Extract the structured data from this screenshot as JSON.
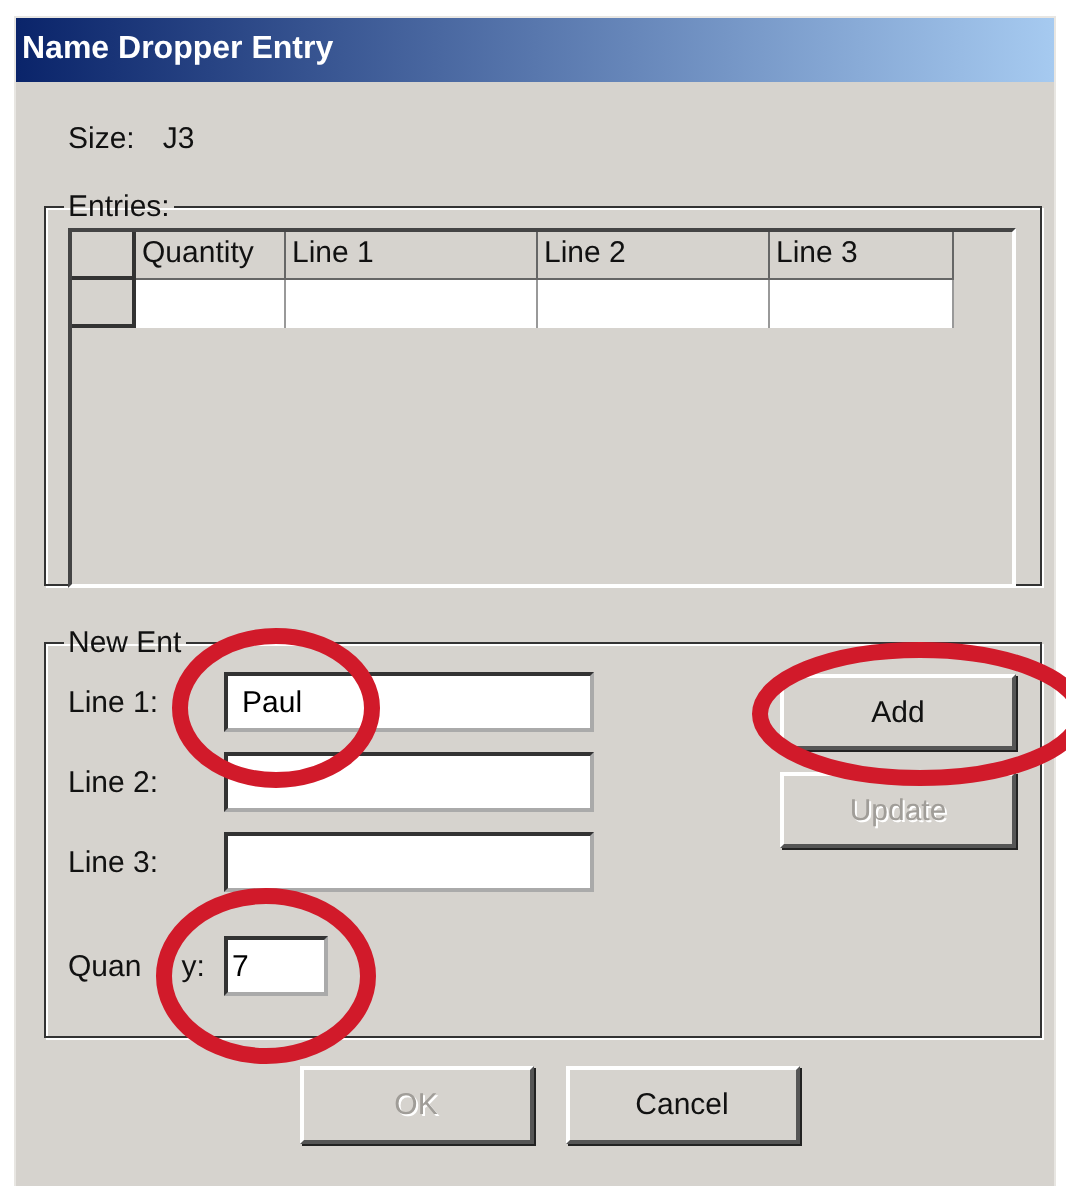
{
  "window": {
    "title": "Name Dropper Entry"
  },
  "size": {
    "label": "Size:",
    "value": "J3"
  },
  "entries": {
    "legend": "Entries:",
    "table": {
      "columns": [
        "Quantity",
        "Line 1",
        "Line 2",
        "Line 3"
      ],
      "rows": [
        [
          "",
          "",
          "",
          ""
        ]
      ]
    }
  },
  "new_entry": {
    "legend": "New Ent",
    "fields": [
      {
        "label": "Line 1:",
        "value": "Paul"
      },
      {
        "label": "Line 2:"
      },
      {
        "label": "Line 3:"
      }
    ],
    "quantity": {
      "label": "Quan",
      "label_end": "y:",
      "value": "7"
    },
    "buttons": [
      {
        "label": "Add",
        "disabled": false
      },
      {
        "label": "Update",
        "disabled": true
      }
    ]
  },
  "buttons": [
    {
      "label": "OK",
      "disabled": true
    },
    {
      "label": "Cancel",
      "disabled": false
    }
  ]
}
